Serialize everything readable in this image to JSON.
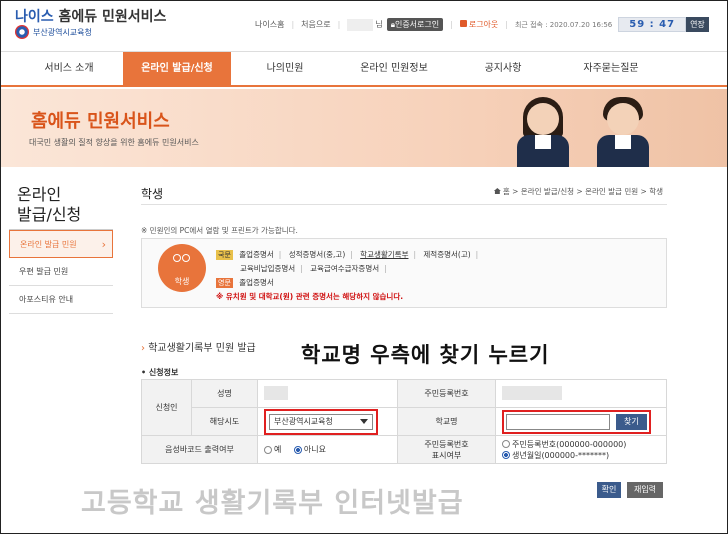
{
  "header": {
    "logo_title_a": "나이스",
    "logo_title_b": " 홈에듀 민원서비스",
    "logo_sub": "부산광역시교육청",
    "util": {
      "home": "나이스홈",
      "first": "처음으로",
      "name_suffix": "님",
      "cert_login": "인증서로그인",
      "logout": "로그아웃",
      "last_access": "최근 접속 : 2020.07.20 16:56",
      "timer": "59 : 47",
      "extend": "연장"
    }
  },
  "gnb": {
    "items": [
      {
        "label": "서비스 소개"
      },
      {
        "label": "온라인 발급/신청"
      },
      {
        "label": "나의민원"
      },
      {
        "label": "온라인 민원정보"
      },
      {
        "label": "공지사항"
      },
      {
        "label": "자주묻는질문"
      }
    ]
  },
  "banner": {
    "title": "홈에듀 민원서비스",
    "subtitle": "대국민 생활의 질적 향상을 위한 홈에듀 민원서비스"
  },
  "lnb": {
    "title_line1": "온라인",
    "title_line2": "발급/신청",
    "items": [
      {
        "label": "온라인 발급 민원"
      },
      {
        "label": "우편 발급 민원"
      },
      {
        "label": "아포스티유 안내"
      }
    ]
  },
  "content": {
    "title": "학생",
    "breadcrumb": "홈 > 온라인 발급/신청 > 온라인 발급 민원 > 학생",
    "notice": "※ 민원인의 PC에서 열람 및 프린트가 가능합니다.",
    "icon_label": "학생",
    "tag_kor": "국문",
    "tag_eng": "영문",
    "docs_row1": [
      "졸업증명서",
      "성적증명서(중,고)",
      "학교생활기록부",
      "제적증명서(고)"
    ],
    "docs_row2": [
      "교육비납입증명서",
      "교육급여수급자증명서"
    ],
    "docs_row3": [
      "졸업증명서"
    ],
    "warning": "※ 유치원 및 대학교(원) 관련 증명서는 해당하지 않습니다.",
    "section_title": "학교생활기록부 민원 발급",
    "overlay_instruction": "학교명 우측에 찾기 누르기",
    "form_label": "신청정보"
  },
  "form": {
    "applicant": "신청인",
    "name_label": "성명",
    "rrn_label": "주민등록번호",
    "region_label": "해당시도",
    "region_value": "부산광역시교육청",
    "school_label": "학교명",
    "school_value": "",
    "find_btn": "찾기",
    "barcode_label": "음성바코드 출력여부",
    "opt_yes": "예",
    "opt_no": "아니요",
    "rrn_display_label_1": "주민등록번호",
    "rrn_display_label_2": "표시여부",
    "rrn_opt_1": "주민등록번호(000000-000000)",
    "rrn_opt_2": "생년월일(000000-*******)"
  },
  "footer": {
    "watermark": "고등학교 생활기록부 인터넷발급",
    "confirm": "확인",
    "reinput": "재입력"
  }
}
